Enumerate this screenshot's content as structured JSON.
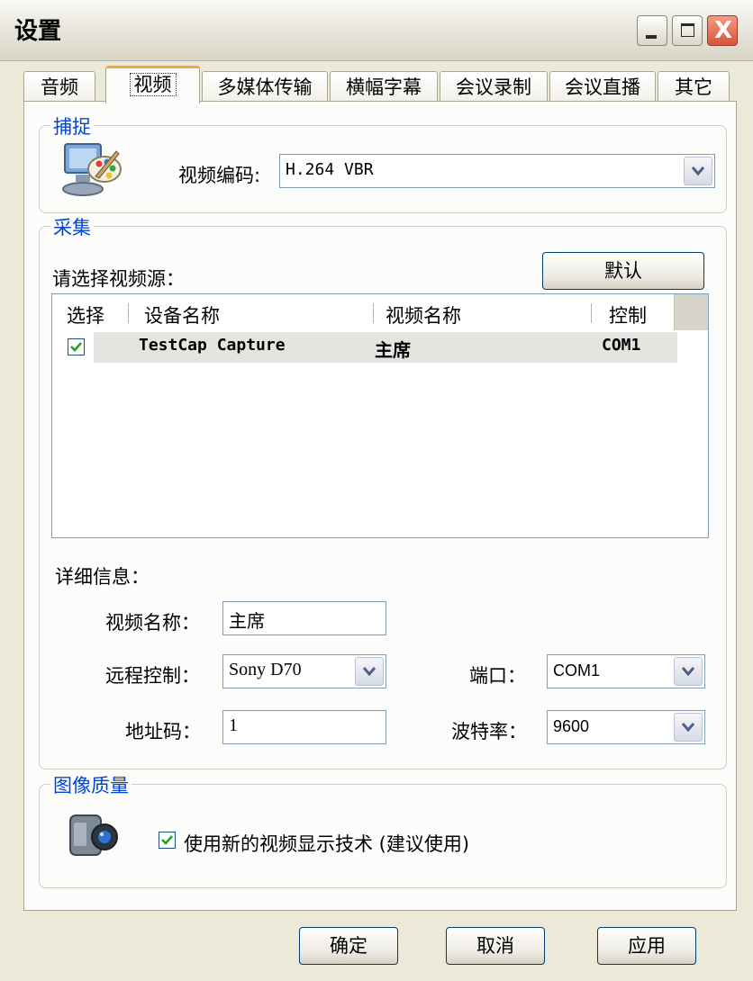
{
  "window": {
    "title": "设置"
  },
  "title_buttons": {
    "minimize_icon": "minimize-icon",
    "maximize_icon": "maximize-icon",
    "close_glyph": "X"
  },
  "tabs": [
    {
      "label": "音频",
      "active": false
    },
    {
      "label": "视频",
      "active": true
    },
    {
      "label": "多媒体传输",
      "active": false
    },
    {
      "label": "横幅字幕",
      "active": false
    },
    {
      "label": "会议录制",
      "active": false
    },
    {
      "label": "会议直播",
      "active": false
    },
    {
      "label": "其它",
      "active": false
    }
  ],
  "capture": {
    "legend": "捕捉",
    "codec_label": "视频编码:",
    "codec_value": "H.264 VBR"
  },
  "collect": {
    "legend": "采集",
    "prompt": "请选择视频源：",
    "default_button": "默认",
    "columns": [
      "选择",
      "设备名称",
      "视频名称",
      "控制"
    ],
    "rows": [
      {
        "checked": true,
        "device": "TestCap Capture",
        "video_name": "主席",
        "control": "COM1"
      }
    ],
    "detail_label": "详细信息：",
    "video_name_label": "视频名称：",
    "video_name_value": "主席",
    "remote_label": "远程控制：",
    "remote_value": "Sony D70",
    "port_label": "端口：",
    "port_value": "COM1",
    "address_label": "地址码：",
    "address_value": "1",
    "baud_label": "波特率：",
    "baud_value": "9600"
  },
  "quality": {
    "legend": "图像质量",
    "checkbox_checked": true,
    "checkbox_label": "使用新的视频显示技术 (建议使用)"
  },
  "footer": {
    "ok": "确定",
    "cancel": "取消",
    "apply": "应用"
  },
  "colors": {
    "accent": "#0046d5",
    "tab_highlight": "#f2a73d",
    "close_red": "#d9533b",
    "checkmark": "#21a121"
  }
}
